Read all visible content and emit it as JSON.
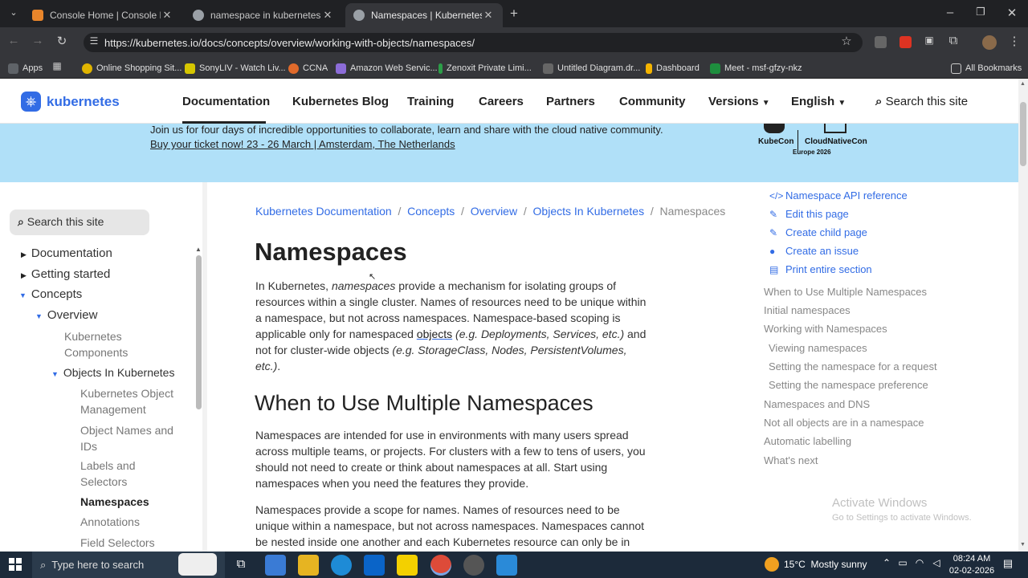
{
  "browser": {
    "tabs": [
      {
        "title": "Console Home | Console Home",
        "favicon_color": "#e8852b"
      },
      {
        "title": "namespace in kubernetes - Goo",
        "favicon_color": "#4285f4"
      },
      {
        "title": "Namespaces | Kubernetes",
        "favicon_color": "#9aa0a6"
      }
    ],
    "url": "https://kubernetes.io/docs/concepts/overview/working-with-objects/namespaces/",
    "bookmarks": [
      "Apps",
      "Online Shopping Sit...",
      "SonyLIV - Watch Liv...",
      "CCNA",
      "Amazon Web Servic...",
      "Zenoxit Private Limi...",
      "Untitled Diagram.dr...",
      "Dashboard",
      "Meet - msf-gfzy-nkz"
    ],
    "all_bookmarks": "All Bookmarks"
  },
  "site": {
    "logo": "kubernetes",
    "nav": [
      "Documentation",
      "Kubernetes Blog",
      "Training",
      "Careers",
      "Partners",
      "Community",
      "Versions",
      "English"
    ],
    "search_placeholder": "Search this site",
    "banner_line1": "Join us for four days of incredible opportunities to collaborate, learn and share with the cloud native community.",
    "banner_line2": "Buy your ticket now! 23 - 26 March | Amsterdam, The Netherlands",
    "kubecon": "KubeCon",
    "cloudnativecon": "CloudNativeCon",
    "europe": "Europe 2026",
    "accent": "#326ce5",
    "banner_color": "#b0e0f8"
  },
  "sidebar": {
    "search": "Search this site",
    "items": [
      "Documentation",
      "Getting started",
      "Concepts",
      "Overview",
      "Kubernetes Components",
      "Objects In Kubernetes",
      "Kubernetes Object Management",
      "Object Names and IDs",
      "Labels and Selectors",
      "Namespaces",
      "Annotations",
      "Field Selectors"
    ]
  },
  "breadcrumb": [
    "Kubernetes Documentation",
    "Concepts",
    "Overview",
    "Objects In Kubernetes",
    "Namespaces"
  ],
  "content": {
    "title": "Namespaces",
    "intro_a": "In Kubernetes, ",
    "intro_em": "namespaces",
    "intro_b": " provide a mechanism for isolating groups of resources within a single cluster. Names of resources need to be unique within a namespace, but not across namespaces. Namespace-based scoping is applicable only for namespaced ",
    "intro_link": "objects",
    "intro_em2": " (e.g. Deployments, Services, etc.)",
    "intro_c": " and not for cluster-wide objects ",
    "intro_em3": "(e.g. StorageClass, Nodes, PersistentVolumes, etc.)",
    "intro_d": ".",
    "h2": "When to Use Multiple Namespaces",
    "p2": "Namespaces are intended for use in environments with many users spread across multiple teams, or projects. For clusters with a few to tens of users, you should not need to create or think about namespaces at all. Start using namespaces when you need the features they provide.",
    "p3": "Namespaces provide a scope for names. Names of resources need to be unique within a namespace, but not across namespaces. Namespaces cannot be nested inside one another and each Kubernetes resource can only be in"
  },
  "right": {
    "links": [
      "Namespace API reference",
      "Edit this page",
      "Create child page",
      "Create an issue",
      "Print entire section"
    ],
    "toc": [
      "When to Use Multiple Namespaces",
      "Initial namespaces",
      "Working with Namespaces",
      "Viewing namespaces",
      "Setting the namespace for a request",
      "Setting the namespace preference",
      "Namespaces and DNS",
      "Not all objects are in a namespace",
      "Automatic labelling",
      "What's next"
    ],
    "watermark1": "Activate Windows",
    "watermark2": "Go to Settings to activate Windows."
  },
  "taskbar": {
    "search": "Type here to search",
    "weather": "15°C  Mostly sunny",
    "time": "08:24 AM",
    "date": "02-02-2026"
  }
}
